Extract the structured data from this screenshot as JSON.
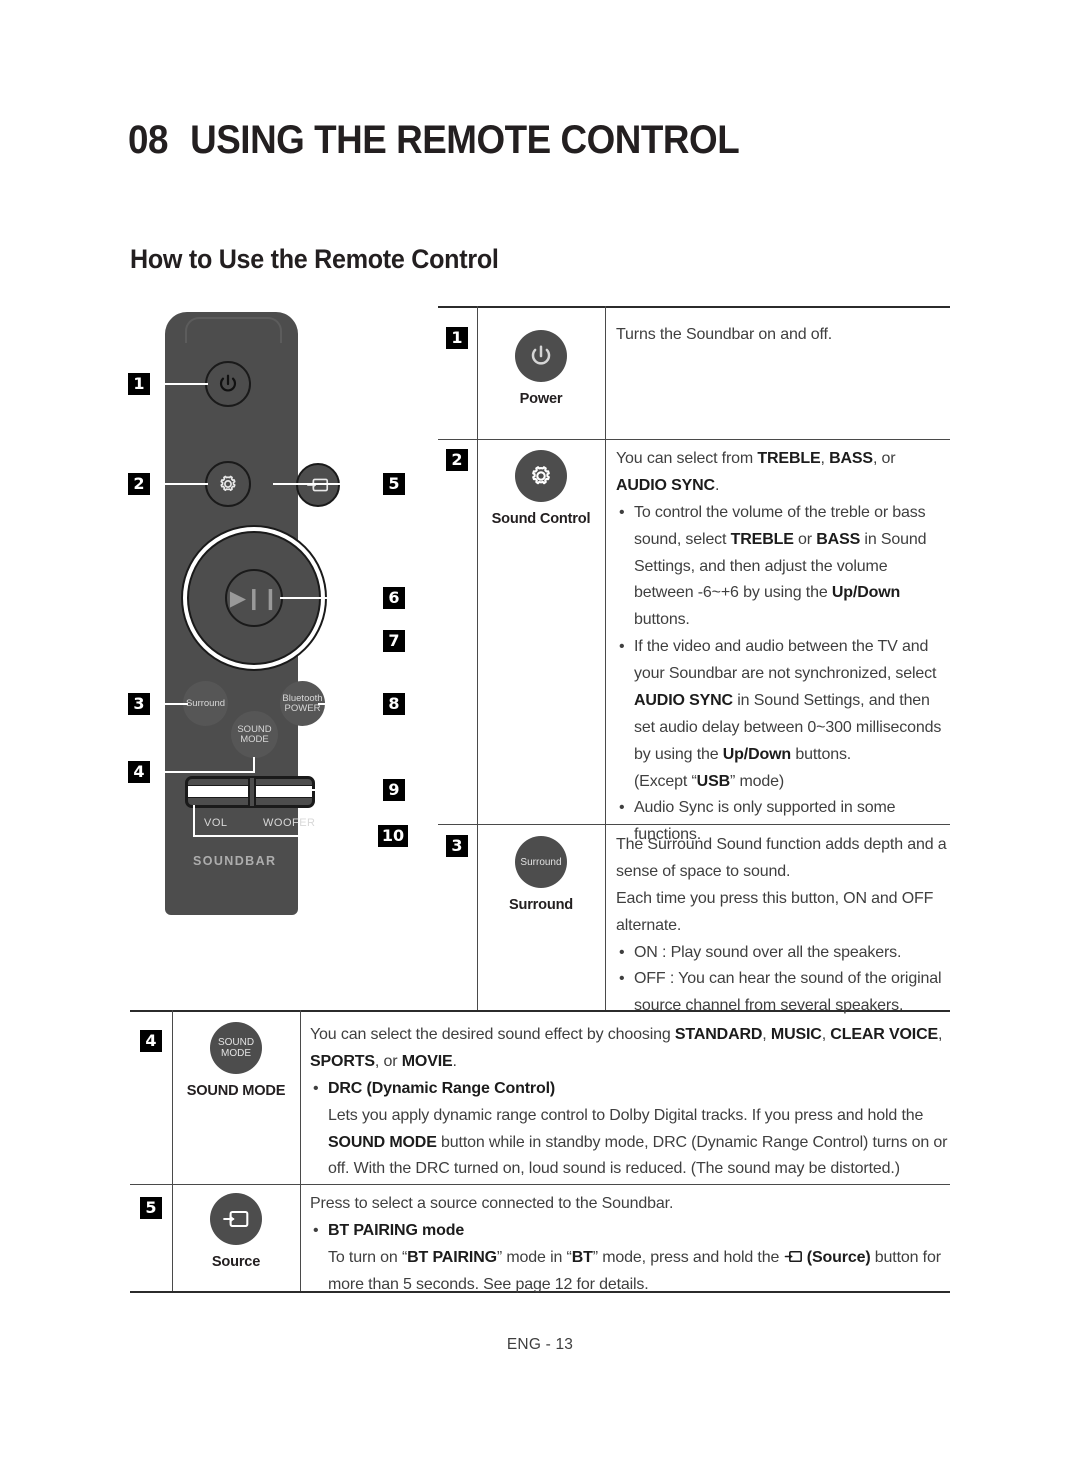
{
  "header": {
    "chapter_number": "08",
    "chapter_title": "USING THE REMOTE CONTROL",
    "section_title": "How to Use the Remote Control"
  },
  "remote_diagram": {
    "buttons": {
      "power": "power-icon",
      "sound_control": "gear-icon",
      "source": "source-icon",
      "play_pause": "▶❙❙",
      "surround": "Surround",
      "bluetooth_line1": "Bluetooth",
      "bluetooth_line2": "POWER",
      "sound_mode_line1": "SOUND",
      "sound_mode_line2": "MODE",
      "vol_label": "VOL",
      "woofer_label": "WOOFER",
      "brand_label": "SOUNDBAR"
    },
    "callouts": [
      "1",
      "2",
      "3",
      "4",
      "5",
      "6",
      "7",
      "8",
      "9",
      "10"
    ]
  },
  "table": {
    "rows": [
      {
        "number": "1",
        "icon": "power-icon",
        "caption": "Power",
        "body_html": "Turns the Soundbar on and off."
      },
      {
        "number": "2",
        "icon": "gear-icon",
        "caption": "Sound Control",
        "intro_html": "You can select from <b>TREBLE</b>, <b>BASS</b>, or <b>AUDIO SYNC</b>.",
        "bullets_html": [
          "To control the volume of the treble or bass sound, select <b>TREBLE</b> or <b>BASS</b> in Sound Settings, and then adjust the volume between -6~+6 by using the <b>Up/Down</b> buttons.",
          "If the video and audio between the TV and your Soundbar are not synchronized, select <b>AUDIO SYNC</b> in Sound Settings, and then set audio delay between 0~300 milliseconds by using the <b>Up/Down</b> buttons.<br>(Except “<b>USB</b>” mode)",
          "Audio Sync is only supported in some functions."
        ]
      },
      {
        "number": "3",
        "icon": "surround-button",
        "icon_text": "Surround",
        "caption": "Surround",
        "intro_html": "The Surround Sound function adds depth and a sense of space to sound.<br>Each time you press this button, ON and OFF alternate.",
        "bullets_html": [
          "ON : Play sound over all the speakers.",
          "OFF : You can hear the sound of the original source channel from several speakers."
        ]
      },
      {
        "number": "4",
        "icon": "sound-mode-button",
        "icon_text_line1": "SOUND",
        "icon_text_line2": "MODE",
        "caption": "SOUND MODE",
        "intro_html": "You can select the desired sound effect by choosing <b>STANDARD</b>, <b>MUSIC</b>, <b>CLEAR VOICE</b>, <b>SPORTS</b>, or <b>MOVIE</b>.",
        "bullets_html": [
          "<b>DRC (Dynamic Range Control)</b>"
        ],
        "trailing_html": "Lets you apply dynamic range control to Dolby Digital tracks. If you press and hold the <b>SOUND MODE</b> button while in standby mode, DRC (Dynamic Range Control) turns on or off. With the DRC turned on, loud sound is reduced. (The sound may be distorted.)"
      },
      {
        "number": "5",
        "icon": "source-icon",
        "caption": "Source",
        "intro_html": "Press to select a source connected to the Soundbar.",
        "bullets_html": [
          "<b>BT PAIRING mode</b>"
        ],
        "trailing_html": "To turn on “<b>BT PAIRING</b>” mode in “<b>BT</b>” mode, press and hold the SRC_ICON <b>(Source)</b> button for more than 5 seconds. See page 12 for details."
      }
    ]
  },
  "footer": {
    "page_label": "ENG - 13"
  },
  "colors": {
    "remote_body": "#4d4d4d",
    "button_fill": "#4d4d4d",
    "badge_bg": "#000000",
    "badge_fg": "#ffffff",
    "text": "#3f3f3f",
    "rule": "#4a4a4a"
  }
}
